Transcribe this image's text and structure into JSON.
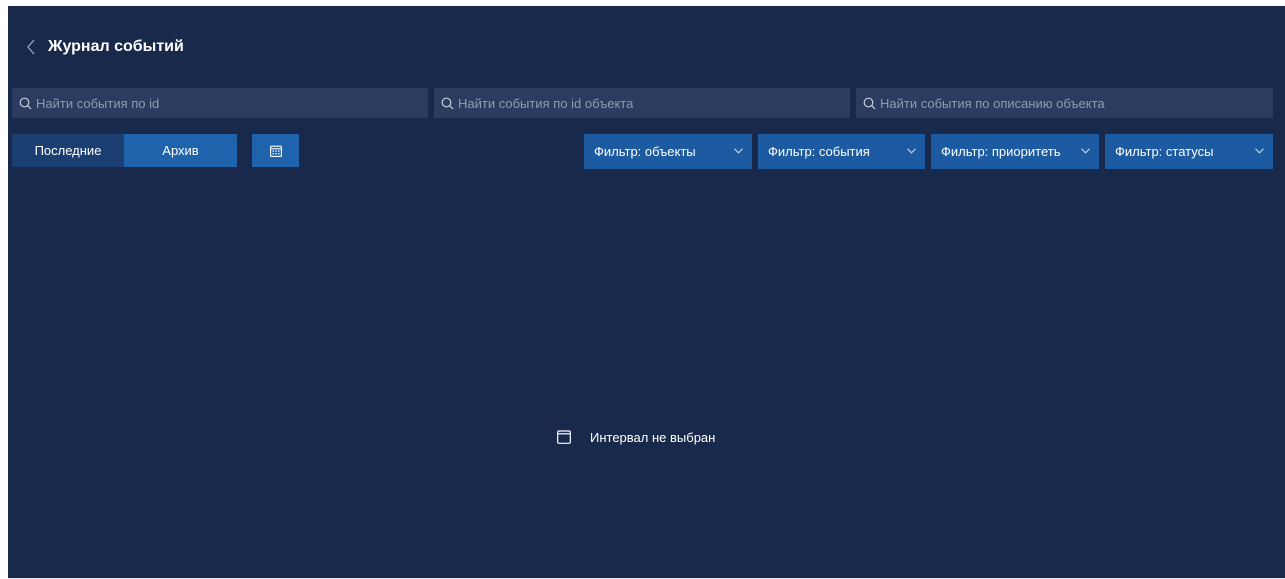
{
  "header": {
    "back_icon": "chevron-left-icon",
    "title": "Журнал событий"
  },
  "search": {
    "by_id": {
      "placeholder": "Найти события по id",
      "icon": "search-icon"
    },
    "by_object_id": {
      "placeholder": "Найти события по id объекта",
      "icon": "search-icon"
    },
    "by_description": {
      "placeholder": "Найти события по описанию объекта",
      "icon": "search-icon"
    }
  },
  "mode_toggle": {
    "options": [
      {
        "label": "Последние",
        "active": false
      },
      {
        "label": "Архив",
        "active": true
      }
    ]
  },
  "calendar_button": {
    "icon": "calendar-icon"
  },
  "filters": [
    {
      "label": "Фильтр: объекты",
      "icon": "chevron-down-icon"
    },
    {
      "label": "Фильтр: события",
      "icon": "chevron-down-icon"
    },
    {
      "label": "Фильтр: приоритеть",
      "icon": "chevron-down-icon"
    },
    {
      "label": "Фильтр: статусы",
      "icon": "chevron-down-icon"
    }
  ],
  "empty_state": {
    "icon": "calendar-outline-icon",
    "message": "Интервал не выбран"
  },
  "colors": {
    "background": "#18294c",
    "input_background": "#2a3d60",
    "active_accent": "#1f63ad",
    "inactive_segment": "#1c3f72",
    "filter_background": "#1c5aa2"
  }
}
